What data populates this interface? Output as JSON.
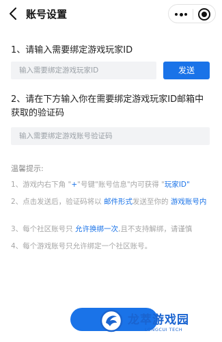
{
  "header": {
    "title": "账号设置"
  },
  "step1": {
    "label": "1、请输入需要绑定游戏玩家ID",
    "placeholder": "输入需要绑定游戏玩家ID",
    "send_label": "发送"
  },
  "step2": {
    "label": "2、请在下方输入你在需要绑定游戏玩家ID邮箱中获取的验证码",
    "placeholder": "输入需要绑定游戏账号验证码"
  },
  "tips": {
    "title": "温馨提示:",
    "t1_a": "1、游戏内右下角 \"",
    "t1_b": "+",
    "t1_c": "\"号键\"账号信息\"内可获得 \"",
    "t1_d": "玩家ID",
    "t1_e": "\"",
    "t2_a": "2、点击发送后，验证码将以 ",
    "t2_b": "邮件形式",
    "t2_c": "发送至你的 ",
    "t2_d": "游戏账号",
    "t2_e": "内",
    "t3_a": "3、每个社区账号只 ",
    "t3_b": "允许换绑一次",
    "t3_c": ",且不支持解绑，请谨慎",
    "t4": "4、每个游戏账号只允许绑定一个社区账号。"
  },
  "watermark": {
    "title": "龙萃游戏园",
    "subtitle": "LONGCUI TECH"
  },
  "colors": {
    "accent": "#1a73e8",
    "input_bg": "#f2f3f5",
    "tip_text": "#a6a6a6"
  }
}
